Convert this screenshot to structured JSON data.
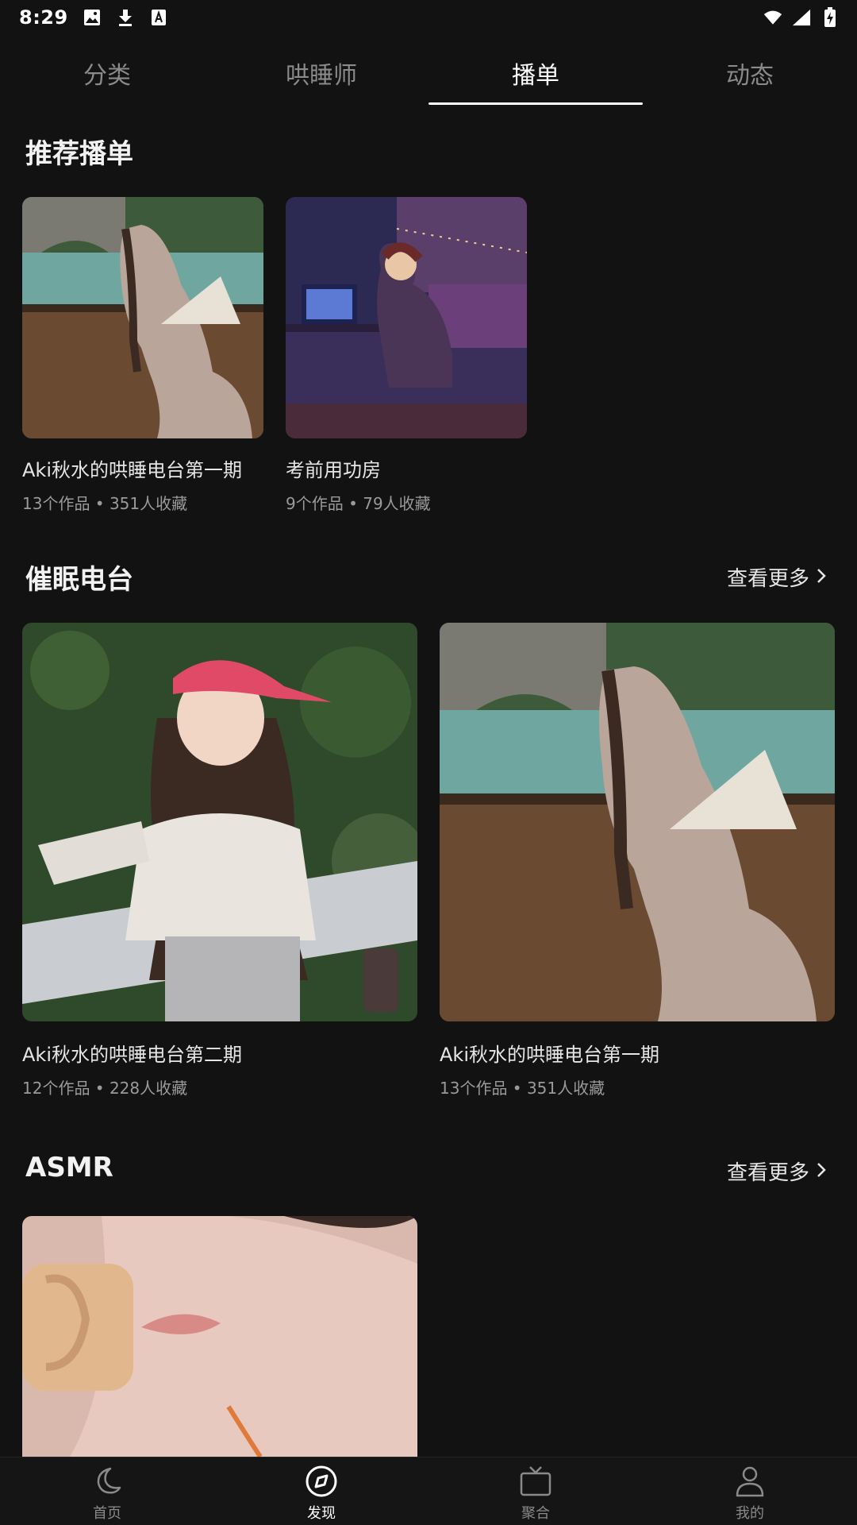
{
  "status_bar": {
    "time": "8:29",
    "icons": [
      "image-icon",
      "download-icon",
      "font-icon",
      "wifi-icon",
      "signal-icon",
      "battery-charging-icon"
    ]
  },
  "tabs": [
    {
      "label": "分类",
      "active": false
    },
    {
      "label": "哄睡师",
      "active": false
    },
    {
      "label": "播单",
      "active": true
    },
    {
      "label": "动态",
      "active": false
    }
  ],
  "sections": {
    "recommended": {
      "title": "推荐播单",
      "items": [
        {
          "title": "Aki秋水的哄睡电台第一期",
          "meta": "13个作品 • 351人收藏",
          "image": "girl-with-fan-by-river-photo"
        },
        {
          "title": "考前用功房",
          "meta": "9个作品 • 79人收藏",
          "image": "girl-studying-at-desk-illustration"
        }
      ]
    },
    "hypnosis": {
      "title": "催眠电台",
      "more_label": "查看更多",
      "items": [
        {
          "title": "Aki秋水的哄睡电台第二期",
          "meta": "12个作品 • 228人收藏",
          "image": "girl-in-pink-cap-photo"
        },
        {
          "title": "Aki秋水的哄睡电台第一期",
          "meta": "13个作品 • 351人收藏",
          "image": "girl-with-fan-by-river-photo"
        }
      ]
    },
    "asmr": {
      "title": "ASMR",
      "more_label": "查看更多",
      "items": [
        {
          "image": "girl-with-ear-microphone-photo"
        }
      ]
    }
  },
  "bottom_nav": [
    {
      "label": "首页",
      "icon": "moon-icon",
      "active": false
    },
    {
      "label": "发现",
      "icon": "compass-icon",
      "active": true
    },
    {
      "label": "聚合",
      "icon": "tv-icon",
      "active": false
    },
    {
      "label": "我的",
      "icon": "user-icon",
      "active": false
    }
  ]
}
